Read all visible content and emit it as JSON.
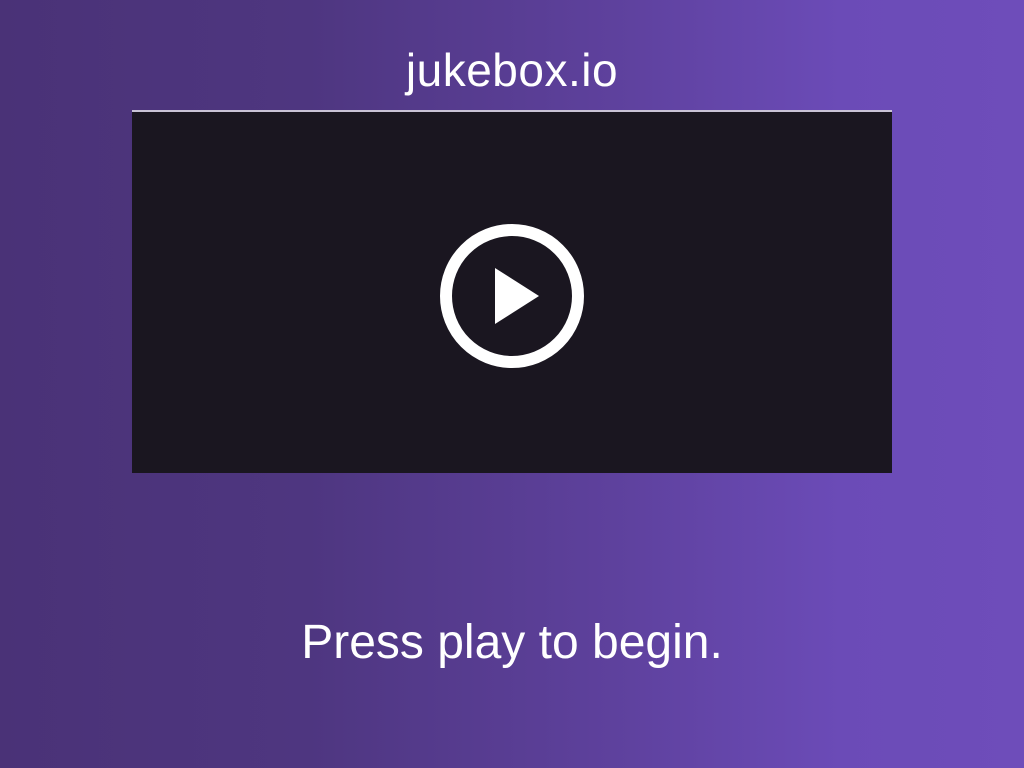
{
  "app": {
    "title": "jukebox.io"
  },
  "player": {
    "play_icon": "play-circle-icon",
    "background_color": "#1a1620",
    "icon_color": "#ffffff"
  },
  "status": {
    "message": "Press play to begin."
  },
  "colors": {
    "background_gradient_start": "#4a3277",
    "background_gradient_end": "#6e4dba",
    "text": "#ffffff"
  }
}
